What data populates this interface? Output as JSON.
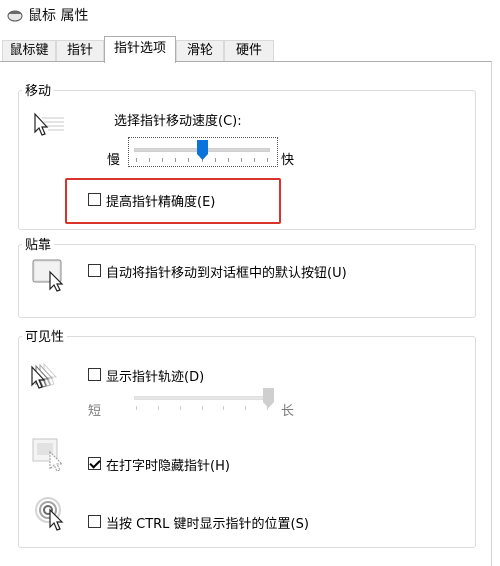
{
  "window": {
    "title": "鼠标 属性"
  },
  "tabs": [
    {
      "label": "鼠标键",
      "active": false
    },
    {
      "label": "指针",
      "active": false
    },
    {
      "label": "指针选项",
      "active": true
    },
    {
      "label": "滑轮",
      "active": false
    },
    {
      "label": "硬件",
      "active": false
    }
  ],
  "motion": {
    "group_label": "移动",
    "speed_label": "选择指针移动速度(C):",
    "slow_label": "慢",
    "fast_label": "快",
    "speed_level": 0.5,
    "enhance_precision": {
      "label": "提高指针精确度(E)",
      "checked": false
    }
  },
  "snap_to": {
    "group_label": "贴靠",
    "checkbox": {
      "label": "自动将指针移动到对话框中的默认按钮(U)",
      "checked": false
    }
  },
  "visibility": {
    "group_label": "可见性",
    "trails": {
      "label": "显示指针轨迹(D)",
      "checked": false
    },
    "short_label": "短",
    "long_label": "长",
    "trail_level": 1.0,
    "hide_while_typing": {
      "label": "在打字时隐藏指针(H)",
      "checked": true
    },
    "show_location": {
      "label": "当按 CTRL 键时显示指针的位置(S)",
      "checked": false
    }
  },
  "colors": {
    "highlight_box": "#d9342b",
    "slider_thumb": "#0a74da"
  }
}
